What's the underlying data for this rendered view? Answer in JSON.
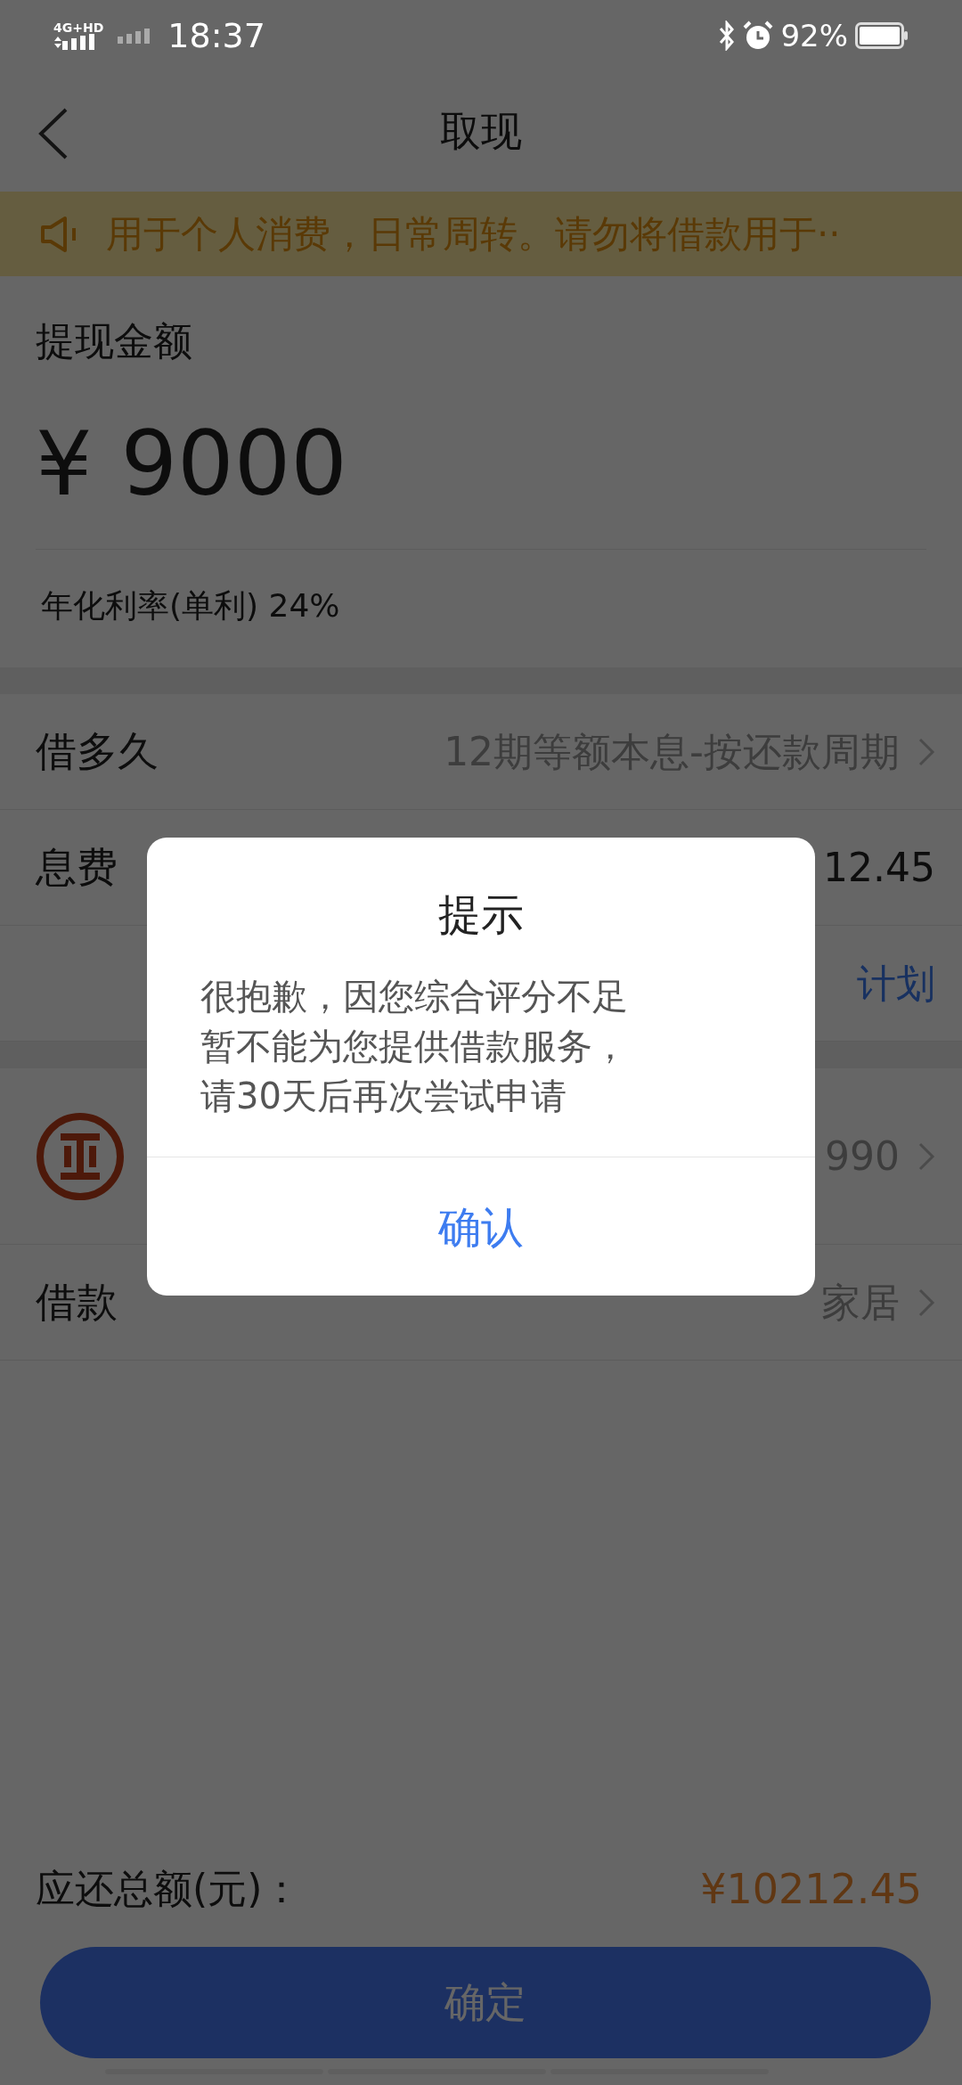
{
  "status_bar": {
    "network": "4G+HD",
    "time": "18:37",
    "battery": "92%"
  },
  "nav": {
    "title": "取现"
  },
  "notice": {
    "text": "用于个人消费，日常周转。请勿将借款用于··"
  },
  "amount": {
    "label": "提现金额",
    "value": "¥ 9000",
    "rate": "年化利率(单利) 24%"
  },
  "rows": [
    {
      "kind": "item",
      "label": "借多久",
      "value": "12期等额本息-按还款周期",
      "chevron": true
    },
    {
      "kind": "item",
      "label": "息费",
      "value": "12.45",
      "chevron": false
    },
    {
      "kind": "link",
      "value": "计划",
      "chevron": false
    },
    {
      "kind": "bank",
      "value": "990",
      "chevron": true
    },
    {
      "kind": "item",
      "label": "借款",
      "value": "家居",
      "chevron": true
    }
  ],
  "footer": {
    "total_label": "应还总额(元)：",
    "total": "¥10212.45",
    "button": "确定"
  },
  "dialog": {
    "title": "提示",
    "message_lines": [
      "很抱歉，因您综合评分不足",
      "暂不能为您提供借款服务，",
      "请30天后再次尝试申请"
    ],
    "button": "确认"
  }
}
